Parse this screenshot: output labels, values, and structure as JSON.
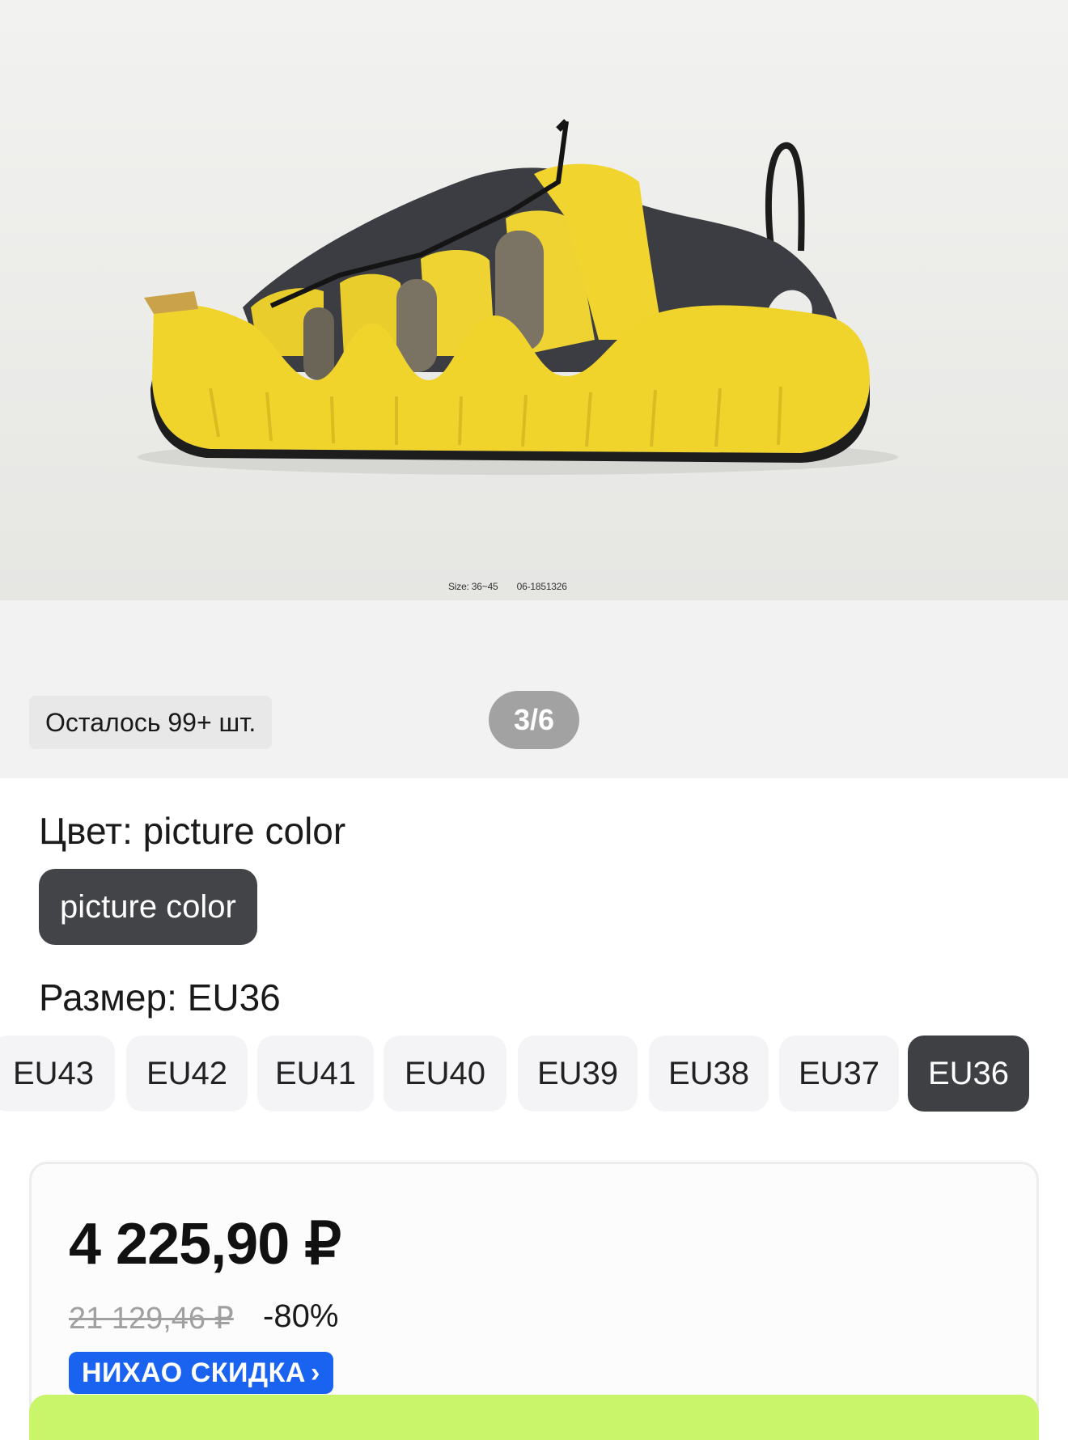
{
  "gallery": {
    "photo_caption": {
      "size_text": "Size: 36~45",
      "code_text": "06-1851326"
    },
    "stock_text": "Осталось 99+ шт.",
    "counter_text": "3/6"
  },
  "product_image": {
    "icon": "sandal-shoe-photo",
    "colors": {
      "yellow": "#f1d52e",
      "dark": "#3b3d42"
    }
  },
  "options": {
    "color_label": "Цвет: picture color",
    "color_chip": "picture color",
    "size_label": "Размер: EU36",
    "sizes": [
      "EU43",
      "EU42",
      "EU41",
      "EU40",
      "EU39",
      "EU38",
      "EU37",
      "EU36"
    ],
    "selected_size": "EU36"
  },
  "price": {
    "current": "4 225,90 ₽",
    "old": "21 129,46 ₽",
    "discount": "-80%",
    "promo_label": "НИХАО СКИДКА",
    "promo_icon": "chevron-right-icon"
  },
  "colors": {
    "accent_green": "#c9f56a",
    "promo_blue": "#1a62f0",
    "chip_dark": "#434447"
  }
}
